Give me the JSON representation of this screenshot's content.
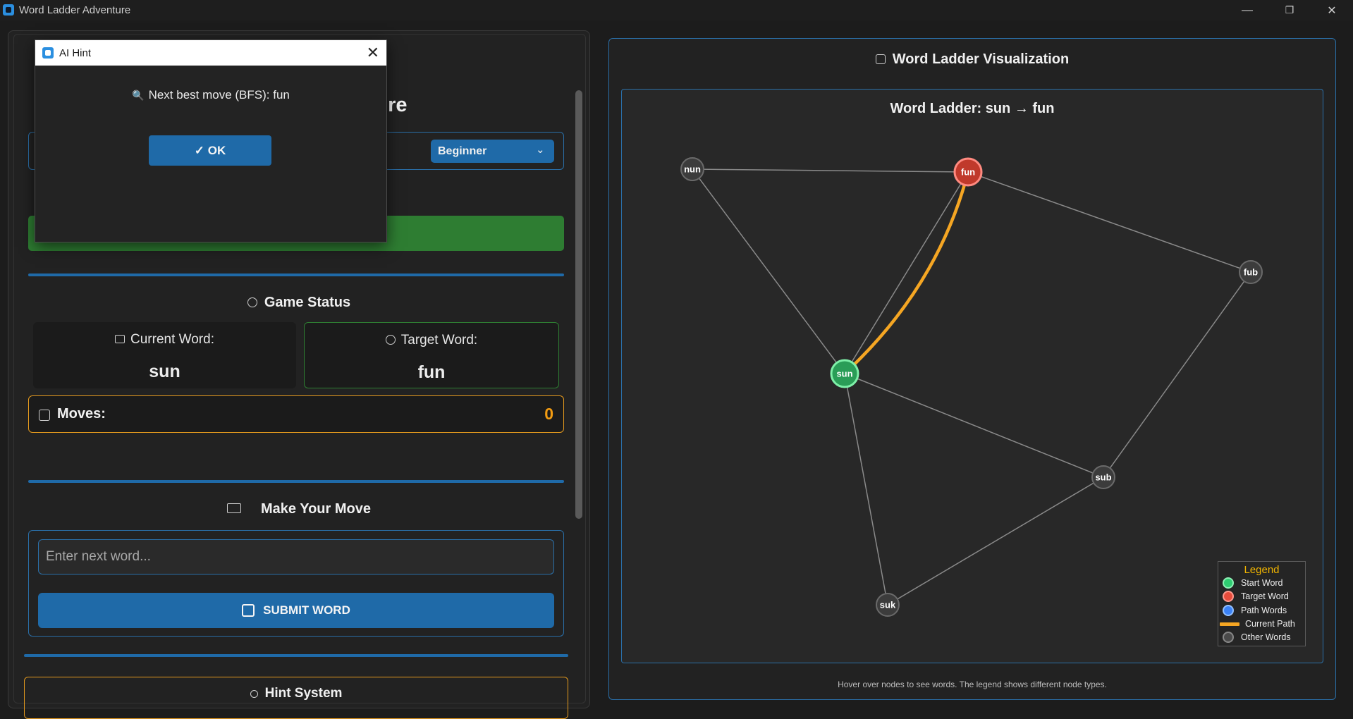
{
  "window": {
    "title": "Word Ladder Adventure",
    "minimize": "—",
    "maximize": "❐",
    "close": "✕"
  },
  "left": {
    "heading_fragment": "nture",
    "difficulty": {
      "selected": "Beginner"
    },
    "game_status": {
      "title": "Game Status",
      "current_label": "Current Word:",
      "current_value": "sun",
      "target_label": "Target Word:",
      "target_value": "fun",
      "moves_label": "Moves:",
      "moves_value": "0"
    },
    "make_move": {
      "title": "Make Your Move",
      "input_placeholder": "Enter next word...",
      "submit_label": "SUBMIT WORD"
    },
    "hint_system": {
      "title": "Hint System"
    }
  },
  "dialog": {
    "title": "AI Hint",
    "message": "Next best move (BFS): fun",
    "ok_label": "✓ OK"
  },
  "visualization": {
    "title": "Word Ladder Visualization",
    "graph_title": "Word Ladder: sun → fun",
    "footnote": "Hover over nodes to see words. The legend shows different node types.",
    "legend": {
      "title": "Legend",
      "items": [
        {
          "label": "Start Word",
          "color": "#2ecc71"
        },
        {
          "label": "Target Word",
          "color": "#e74c3c"
        },
        {
          "label": "Path Words",
          "color": "#3b82f6"
        },
        {
          "label": "Current Path",
          "color": "#f5a623"
        },
        {
          "label": "Other Words",
          "color": "#4a4a4a"
        }
      ]
    },
    "nodes": [
      {
        "word": "nun",
        "type": "other"
      },
      {
        "word": "fun",
        "type": "target"
      },
      {
        "word": "fub",
        "type": "other"
      },
      {
        "word": "sun",
        "type": "start"
      },
      {
        "word": "sub",
        "type": "other"
      },
      {
        "word": "suk",
        "type": "other"
      }
    ],
    "edges": [
      [
        "nun",
        "fun"
      ],
      [
        "nun",
        "sun"
      ],
      [
        "fun",
        "sun"
      ],
      [
        "fun",
        "fub"
      ],
      [
        "fub",
        "sub"
      ],
      [
        "sun",
        "sub"
      ],
      [
        "sun",
        "suk"
      ],
      [
        "suk",
        "sub"
      ]
    ],
    "current_path": [
      [
        "sun",
        "fun"
      ]
    ]
  }
}
